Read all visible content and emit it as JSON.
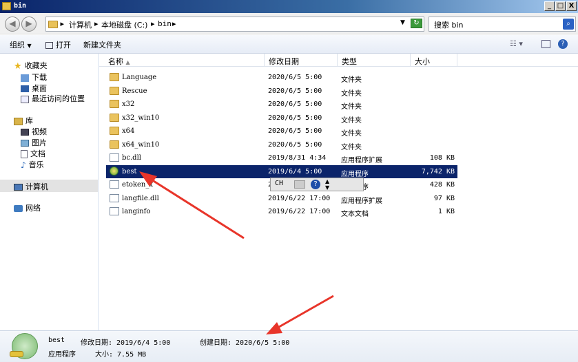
{
  "window": {
    "title": "bin",
    "min": "_",
    "max": "□",
    "close": "X"
  },
  "address": {
    "crumbs": [
      "计算机",
      "本地磁盘 (C:)",
      "bin"
    ],
    "search_placeholder": "搜索 bin"
  },
  "toolbar": {
    "organize": "组织",
    "open": "打开",
    "new_folder": "新建文件夹"
  },
  "nav": {
    "favorites": "收藏夹",
    "downloads": "下载",
    "desktop": "桌面",
    "recent": "最近访问的位置",
    "libraries": "库",
    "videos": "视频",
    "pictures": "图片",
    "documents": "文档",
    "music": "音乐",
    "computer": "计算机",
    "network": "网络"
  },
  "columns": {
    "name": "名称",
    "modified": "修改日期",
    "type": "类型",
    "size": "大小"
  },
  "files": [
    {
      "name": "Language",
      "date": "2020/6/5 5:00",
      "type": "文件夹",
      "size": "",
      "icon": "folder"
    },
    {
      "name": "Rescue",
      "date": "2020/6/5 5:00",
      "type": "文件夹",
      "size": "",
      "icon": "folder"
    },
    {
      "name": "x32",
      "date": "2020/6/5 5:00",
      "type": "文件夹",
      "size": "",
      "icon": "folder"
    },
    {
      "name": "x32_win10",
      "date": "2020/6/5 5:00",
      "type": "文件夹",
      "size": "",
      "icon": "folder"
    },
    {
      "name": "x64",
      "date": "2020/6/5 5:00",
      "type": "文件夹",
      "size": "",
      "icon": "folder"
    },
    {
      "name": "x64_win10",
      "date": "2020/6/5 5:00",
      "type": "文件夹",
      "size": "",
      "icon": "folder"
    },
    {
      "name": "bc.dll",
      "date": "2019/8/31 4:34",
      "type": "应用程序扩展",
      "size": "108 KB",
      "icon": "dll"
    },
    {
      "name": "best",
      "date": "2019/6/4 5:00",
      "type": "应用程序",
      "size": "7,742 KB",
      "icon": "exe",
      "selected": true
    },
    {
      "name": "etoken_x",
      "date": "2019/6/22 17:00",
      "type": "应用程序",
      "size": "428 KB",
      "icon": "dll"
    },
    {
      "name": "langfile.dll",
      "date": "2019/6/22 17:00",
      "type": "应用程序扩展",
      "size": "97 KB",
      "icon": "dll"
    },
    {
      "name": "langinfo",
      "date": "2019/6/22 17:00",
      "type": "文本文档",
      "size": "1 KB",
      "icon": "txt"
    }
  ],
  "ime": {
    "lang": "CH"
  },
  "details": {
    "name": "best",
    "type": "应用程序",
    "modified_label": "修改日期: 2019/6/4 5:00",
    "size_label": "大小: 7.55 MB",
    "created_label": "创建日期: 2020/6/5 5:00"
  },
  "colors": {
    "selection": "#0b246a",
    "annotation_arrow": "#e8352a"
  }
}
